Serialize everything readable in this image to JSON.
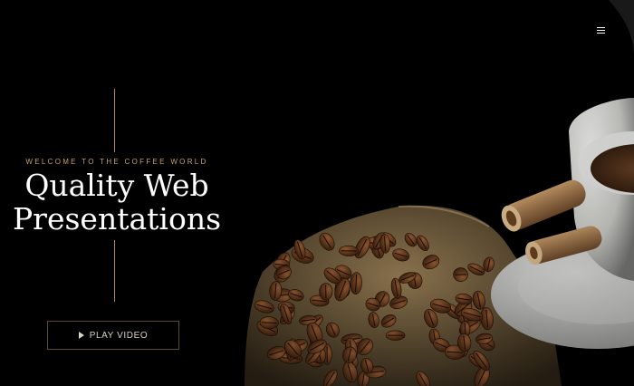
{
  "hero": {
    "eyebrow": "WELCOME TO THE COFFEE WORLD",
    "headline_line1": "Quality Web",
    "headline_line2": "Presentations",
    "play_label": "PLAY VIDEO"
  },
  "icons": {
    "menu": "hamburger-menu-icon",
    "play": "play-icon"
  },
  "colors": {
    "background": "#000000",
    "accent_gold": "#c8a06a",
    "divider_line": "#b08a5a",
    "headline": "#ffffff",
    "button_border": "#5e4a34"
  }
}
